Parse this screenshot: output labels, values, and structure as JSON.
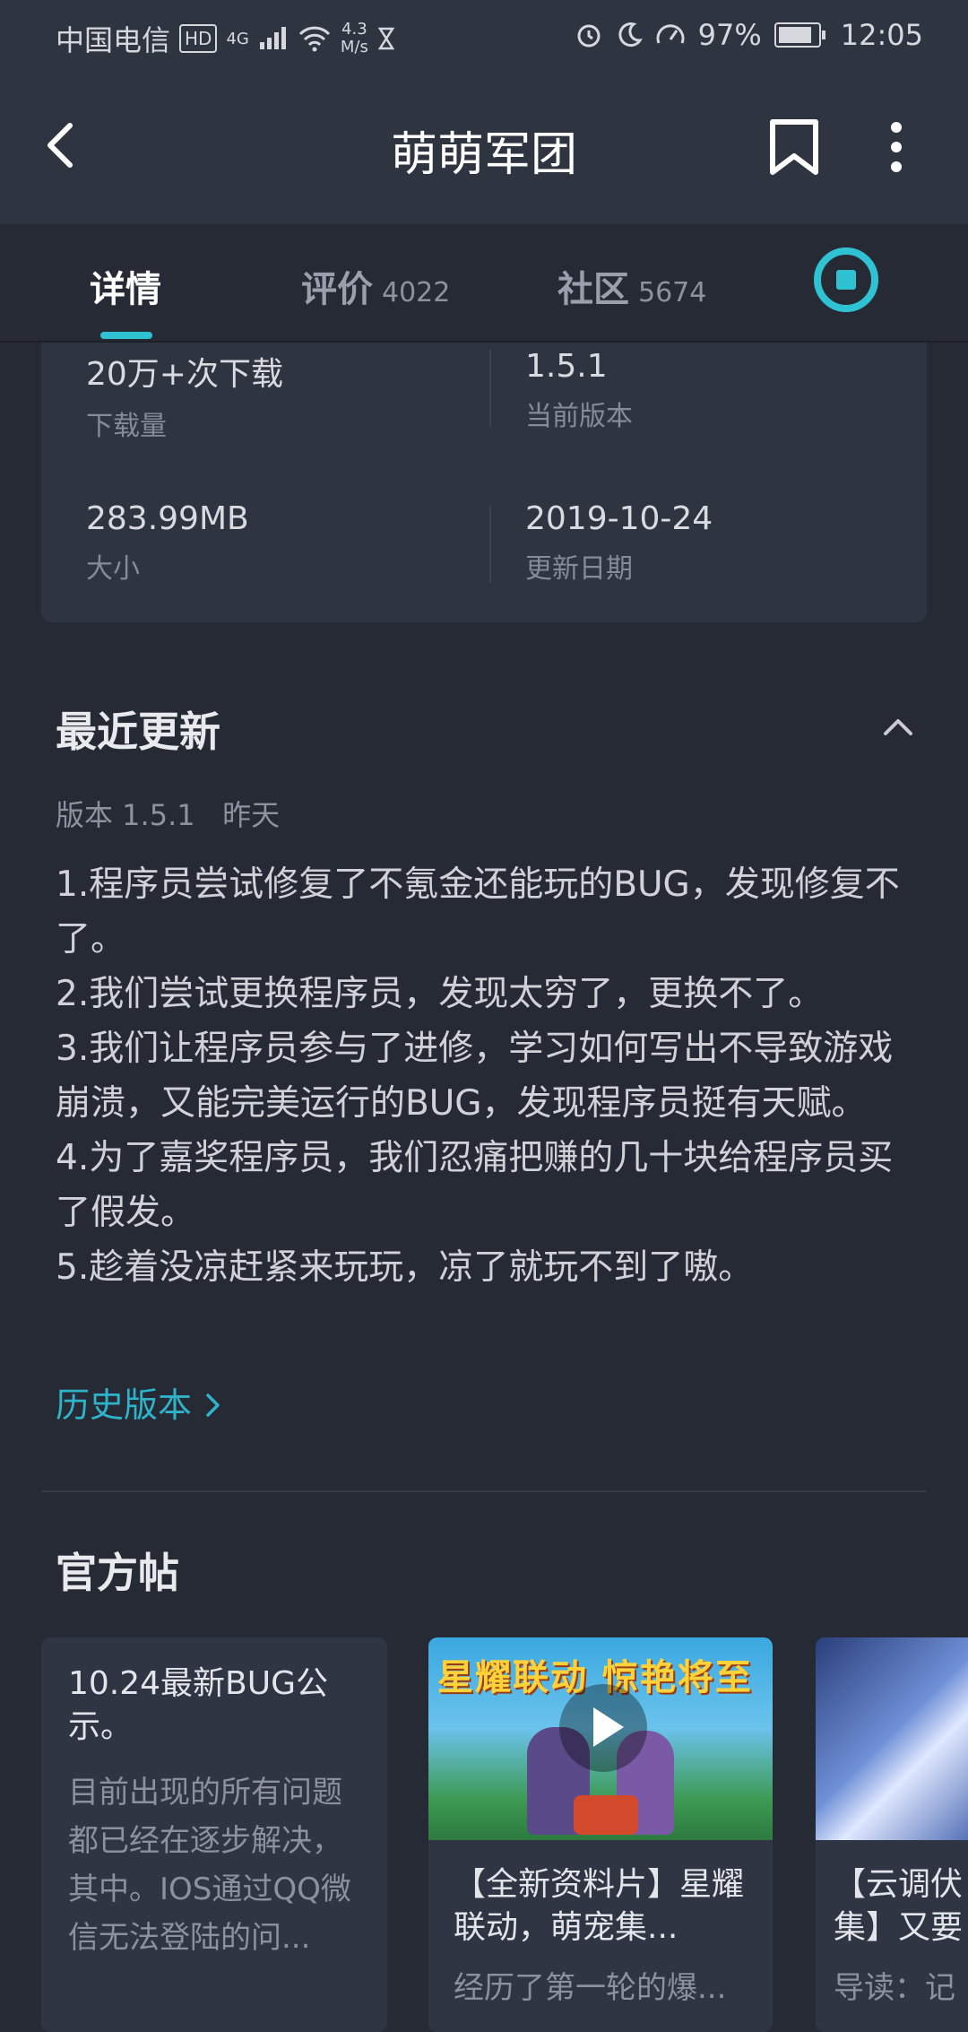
{
  "status_bar": {
    "carrier": "中国电信",
    "hd_badge": "HD",
    "network": "4G",
    "speed_value": "4.3",
    "speed_unit": "M/s",
    "battery": "97%",
    "time": "12:05"
  },
  "header": {
    "title": "萌萌军团"
  },
  "tabs": [
    {
      "label": "详情",
      "count": ""
    },
    {
      "label": "评价",
      "count": "4022"
    },
    {
      "label": "社区",
      "count": "5674"
    }
  ],
  "info": {
    "downloads_value": "20万+次下载",
    "downloads_label": "下载量",
    "version_value": "1.5.1",
    "version_label": "当前版本",
    "size_value": "283.99MB",
    "size_label": "大小",
    "date_value": "2019-10-24",
    "date_label": "更新日期"
  },
  "updates": {
    "title": "最近更新",
    "meta": "版本 1.5.1   昨天",
    "notes": "1.程序员尝试修复了不氪金还能玩的BUG，发现修复不了。\n2.我们尝试更换程序员，发现太穷了，更换不了。\n3.我们让程序员参与了进修，学习如何写出不导致游戏崩溃，又能完美运行的BUG，发现程序员挺有天赋。\n4.为了嘉奖程序员，我们忍痛把赚的几十块给程序员买了假发。\n5.趁着没凉赶紧来玩玩，凉了就玩不到了嗷。",
    "history_link": "历史版本"
  },
  "official_posts": {
    "title": "官方帖",
    "posts": [
      {
        "title": "10.24最新BUG公示。",
        "desc": "目前出现的所有问题都已经在逐步解决，其中。IOS通过QQ微信无法登陆的问..."
      },
      {
        "thumb_text": "星耀联动 惊艳将至",
        "title": "【全新资料片】星耀联动，萌宠集...",
        "desc": "经历了第一轮的爆..."
      },
      {
        "title": "【云调伏集】又要",
        "desc": "导读：记"
      }
    ]
  }
}
